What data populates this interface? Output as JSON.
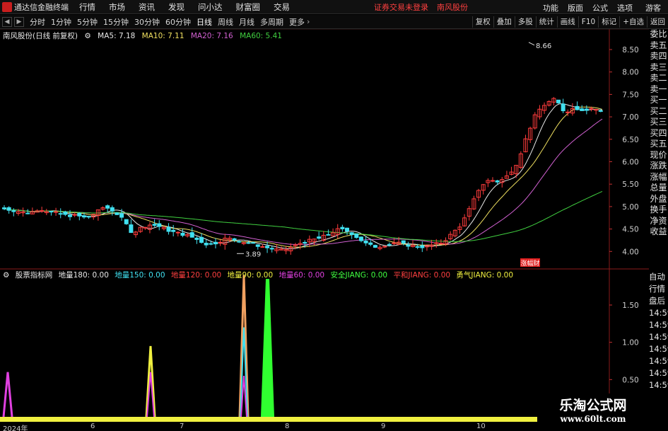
{
  "menubar": {
    "app_title": "通达信金融终端",
    "items": [
      "行情",
      "市场",
      "资讯",
      "发现",
      "问小达",
      "财富圈",
      "交易"
    ],
    "notice": "证券交易未登录",
    "stock_name": "南风股份",
    "right_items": [
      "功能",
      "版面",
      "公式",
      "选项"
    ],
    "guest": "游客"
  },
  "toolbar": {
    "periods": [
      "分时",
      "1分钟",
      "5分钟",
      "15分钟",
      "30分钟",
      "60分钟",
      "日线",
      "周线",
      "月线",
      "多周期",
      "更多"
    ],
    "active_period": "日线",
    "right_buttons": [
      "复权",
      "叠加",
      "多股",
      "统计",
      "画线",
      "F10",
      "标记",
      "+自选",
      "返回"
    ]
  },
  "main_chart": {
    "title": "南风股份(日线 前复权)",
    "ma": [
      {
        "label": "MA5: 7.18",
        "color": "#e8e8e8"
      },
      {
        "label": "MA10: 7.11",
        "color": "#f0e060"
      },
      {
        "label": "MA20: 7.16",
        "color": "#d060d0"
      },
      {
        "label": "MA60: 5.41",
        "color": "#40d040"
      }
    ],
    "price_axis": [
      "8.50",
      "8.00",
      "7.50",
      "7.00",
      "6.50",
      "6.00",
      "5.50",
      "5.00",
      "4.50",
      "4.00"
    ],
    "high_label": "8.66",
    "low_label": "3.89",
    "badge": "涨幅财",
    "colors": {
      "up": "#ff3c3c",
      "down": "#40e0f0",
      "ma5": "#e8e8e8",
      "ma10": "#f0e060",
      "ma20": "#d060d0",
      "ma60": "#40d040"
    }
  },
  "side_panel": [
    "委比",
    "卖五",
    "卖四",
    "卖三",
    "卖二",
    "卖一",
    "买一",
    "买二",
    "买三",
    "买四",
    "买五",
    "现价",
    "涨跌",
    "涨幅",
    "总量",
    "外盘",
    "换手",
    "净资",
    "收益"
  ],
  "side_panel2": [
    "自动",
    "行情",
    "盘后",
    "14:59",
    "14:59",
    "14:59",
    "14:59",
    "14:59",
    "14:59",
    "14:59"
  ],
  "indicator": {
    "title": "股票指标网",
    "fields": [
      {
        "label": "地量180: 0.00",
        "color": "#e8e8e8"
      },
      {
        "label": "地量150: 0.00",
        "color": "#40e0f0"
      },
      {
        "label": "地量120: 0.00",
        "color": "#ff4040"
      },
      {
        "label": "地量90: 0.00",
        "color": "#f0f040"
      },
      {
        "label": "地量60: 0.00",
        "color": "#e040e0"
      },
      {
        "label": "安全JIANG: 0.00",
        "color": "#40ff40"
      },
      {
        "label": "平和JIANG: 0.00",
        "color": "#ff4040"
      },
      {
        "label": "勇气JIANG: 0.00",
        "color": "#f0f040"
      }
    ],
    "axis": [
      "1.50",
      "1.00",
      "0.50"
    ]
  },
  "date_axis": [
    "2024年",
    "6",
    "7",
    "8",
    "9",
    "10"
  ],
  "watermark": {
    "title": "乐淘公式网",
    "url": "www.60lt.com"
  }
}
